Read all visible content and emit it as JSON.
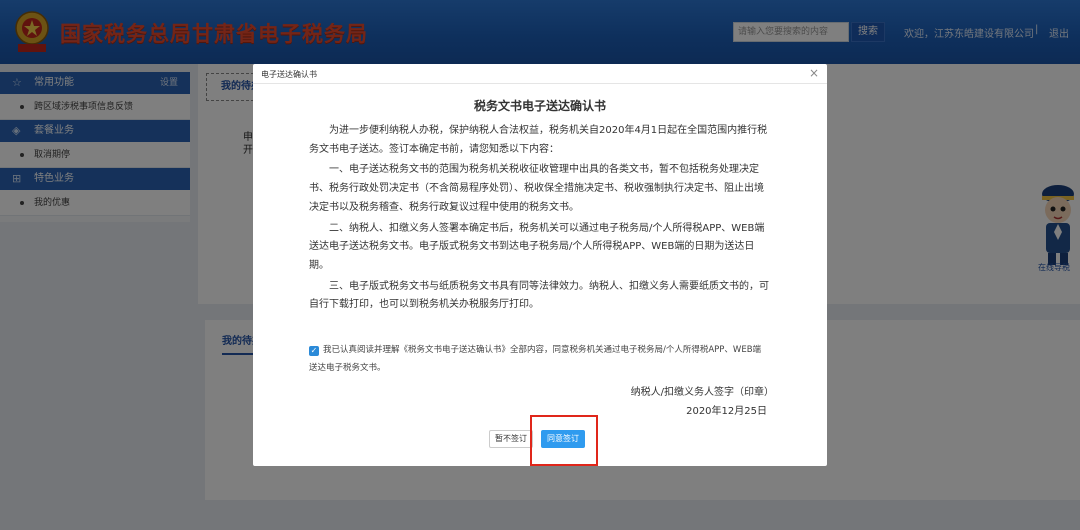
{
  "header": {
    "site_title": "国家税务总局甘肃省电子税务局",
    "search_placeholder": "请输入您要搜索的内容",
    "search_label": "搜索",
    "user_text": "欢迎，江苏东皓建设有限公司",
    "separator": "|",
    "logout_label": "退出",
    "colors": {
      "bar": "#1c5fb8",
      "title": "#e84b2e"
    }
  },
  "sidebar": {
    "sections": [
      {
        "label": "常用功能",
        "icon": "star-icon",
        "right_label": "设置",
        "items": [
          {
            "label": "跨区域涉税事项信息反馈"
          }
        ]
      },
      {
        "label": "套餐业务",
        "icon": "layers-icon",
        "right_label": "",
        "items": [
          {
            "label": "取消期停"
          }
        ]
      },
      {
        "label": "特色业务",
        "icon": "grid-icon",
        "right_label": "",
        "items": [
          {
            "label": "我的优惠"
          }
        ]
      }
    ]
  },
  "background": {
    "todo_tab": "我的待办",
    "text_1": "申",
    "text_2": "开",
    "pending_tab": "我的待办",
    "mascot_label": "在线导税"
  },
  "dialog": {
    "title": "电子送达确认书",
    "close_icon": "close-icon",
    "doc_title": "税务文书电子送达确认书",
    "paragraphs": [
      "为进一步便利纳税人办税，保护纳税人合法权益，税务机关自2020年4月1日起在全国范围内推行税务文书电子送达。签订本确定书前，请您知悉以下内容：",
      "一、电子送达税务文书的范围为税务机关税收征收管理中出具的各类文书，暂不包括税务处理决定书、税务行政处罚决定书（不含简易程序处罚）、税收保全措施决定书、税收强制执行决定书、阻止出境决定书以及税务稽查、税务行政复议过程中使用的税务文书。",
      "二、纳税人、扣缴义务人签署本确定书后，税务机关可以通过电子税务局/个人所得税APP、WEB端送达电子送达税务文书。电子版式税务文书到达电子税务局/个人所得税APP、WEB端的日期为送达日期。",
      "三、电子版式税务文书与纸质税务文书具有同等法律效力。纳税人、扣缴义务人需要纸质文书的，可自行下载打印，也可以到税务机关办税服务厅打印。"
    ],
    "consent_text": "我已认真阅读并理解《税务文书电子送达确认书》全部内容，同意税务机关通过电子税务局/个人所得税APP、WEB端送达电子税务文书。",
    "consent_checked": true,
    "sign_label": "纳税人/扣缴义务人签字（印章）",
    "sign_date": "2020年12月25日",
    "later_label": "暂不签订",
    "agree_label": "同意签订",
    "colors": {
      "agree_button": "#2f9bef",
      "highlight": "#e0261a"
    }
  }
}
